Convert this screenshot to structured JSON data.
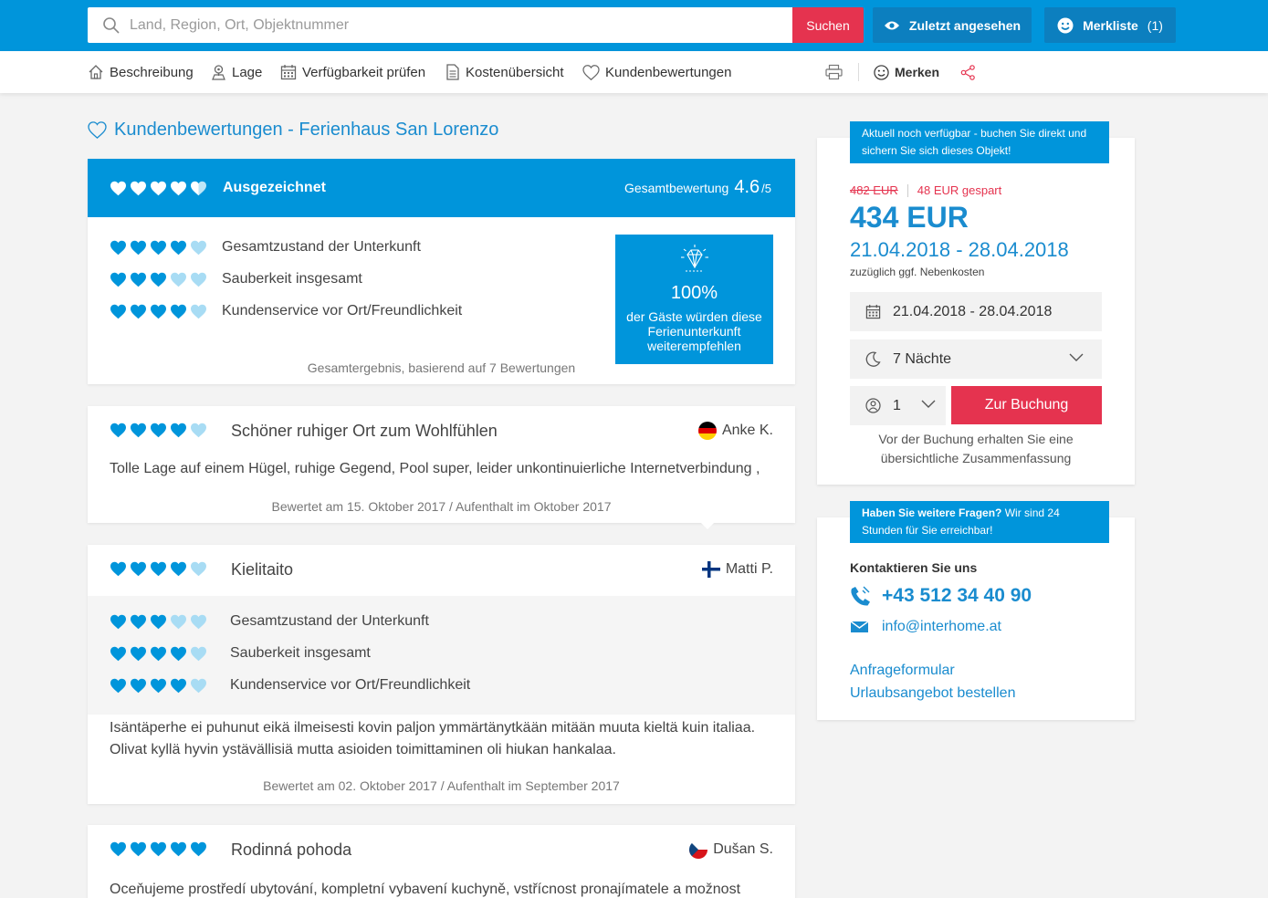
{
  "search": {
    "placeholder": "Land, Region, Ort, Objektnummer",
    "button": "Suchen"
  },
  "topbar": {
    "recently_viewed": "Zuletzt angesehen",
    "watchlist": "Merkliste",
    "watchlist_count": "(1)"
  },
  "subnav": {
    "items": [
      "Beschreibung",
      "Lage",
      "Verfügbarkeit prüfen",
      "Kostenübersicht",
      "Kundenbewertungen"
    ],
    "save": "Merken"
  },
  "page_title": "Kundenbewertungen - Ferienhaus San Lorenzo",
  "summary": {
    "rating_word": "Ausgezeichnet",
    "rating_hearts": 4.5,
    "overall_label": "Gesamtbewertung",
    "overall_value": "4.6",
    "overall_max": "/5",
    "criteria": [
      {
        "label": "Gesamtzustand der Unterkunft",
        "hearts": 4
      },
      {
        "label": "Sauberkeit insgesamt",
        "hearts": 3
      },
      {
        "label": "Kundenservice vor Ort/Freundlichkeit",
        "hearts": 4
      }
    ],
    "recommend_pct": "100%",
    "recommend_text": "der Gäste würden diese Ferienunterkunft weiterempfehlen",
    "basis": "Gesamtergebnis, basierend auf 7 Bewertungen"
  },
  "reviews": [
    {
      "hearts": 4,
      "title": "Schöner ruhiger Ort zum Wohlfühlen",
      "author": "Anke K.",
      "flag": "de",
      "text": "Tolle Lage auf einem Hügel, ruhige Gegend, Pool super, leider unkontinuierliche Internetverbindung ,",
      "meta": "Bewertet am 15. Oktober 2017 / Aufenthalt im Oktober 2017"
    },
    {
      "hearts": 4,
      "title": "Kielitaito",
      "author": "Matti P.",
      "flag": "fi",
      "criteria": [
        {
          "label": "Gesamtzustand der Unterkunft",
          "hearts": 3
        },
        {
          "label": "Sauberkeit insgesamt",
          "hearts": 4
        },
        {
          "label": "Kundenservice vor Ort/Freundlichkeit",
          "hearts": 4
        }
      ],
      "text": "Isäntäperhe ei puhunut eikä ilmeisesti kovin paljon ymmärtänytkään mitään muuta kieltä kuin italiaa. Olivat kyllä hyvin ystävällisiä mutta asioiden toimittaminen oli hiukan hankalaa.",
      "meta": "Bewertet am 02. Oktober 2017 / Aufenthalt im September 2017"
    },
    {
      "hearts": 5,
      "title": "Rodinná pohoda",
      "author": "Dušan S.",
      "flag": "cz",
      "text": "Oceňujeme prostředí ubytování, kompletní vybavení kuchyně, vstřícnost pronajímatele a možnost"
    }
  ],
  "booking": {
    "tag": "Aktuell noch verfügbar - buchen Sie direkt und sichern Sie sich dieses Objekt!",
    "old_price": "482 EUR",
    "saved": "48 EUR gespart",
    "price": "434 EUR",
    "dates": "21.04.2018 - 28.04.2018",
    "extra": "zuzüglich ggf. Nebenkosten",
    "date_field": "21.04.2018 - 28.04.2018",
    "nights": "7 Nächte",
    "persons": "1",
    "book_button": "Zur Buchung",
    "note": "Vor der Buchung erhalten Sie eine übersichtliche Zusammenfassung"
  },
  "contact": {
    "tag_bold": "Haben Sie weitere Fragen?",
    "tag_rest": " Wir sind 24 Stunden für Sie erreichbar!",
    "heading": "Kontaktieren Sie uns",
    "phone": "+43 512 34 40 90",
    "email": "info@interhome.at",
    "link_form": "Anfrageformular",
    "link_offer": "Urlaubsangebot bestellen"
  },
  "colors": {
    "brand_blue": "#0095db",
    "accent_red": "#e5334f",
    "link_blue": "#1a8ccf",
    "heart_light": "#a8dcf4"
  }
}
